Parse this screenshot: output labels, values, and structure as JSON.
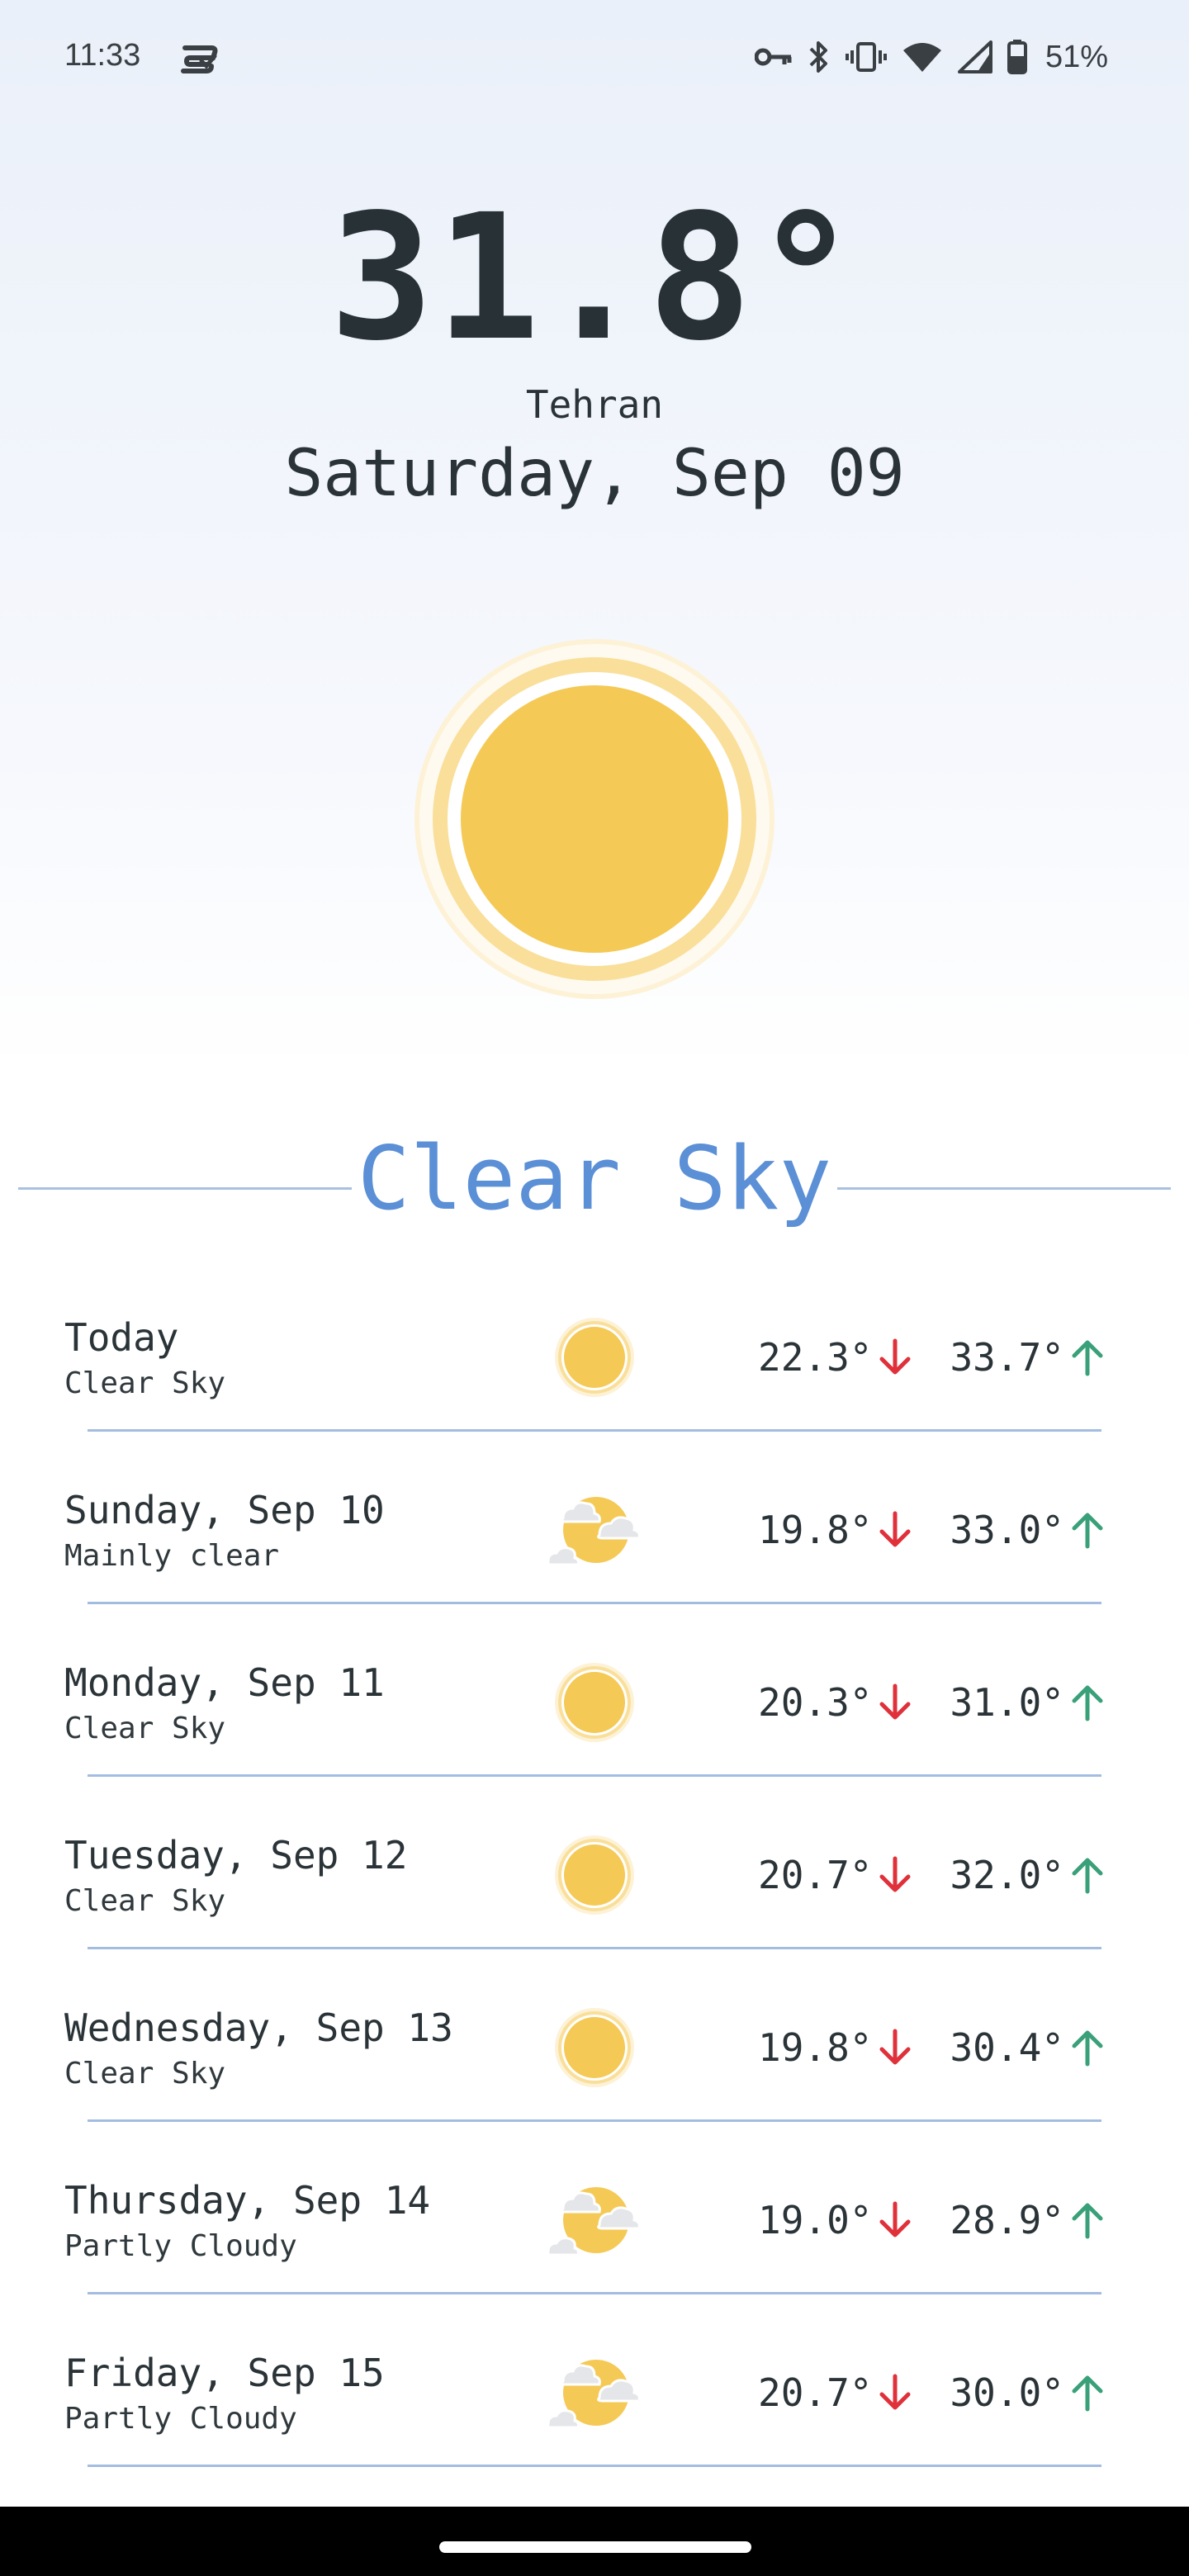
{
  "status_bar": {
    "time": "11:33",
    "battery": "51%",
    "icons": [
      "app-notification-icon",
      "vpn-key-icon",
      "bluetooth-icon",
      "vibrate-icon",
      "wifi-icon",
      "cell-signal-icon",
      "battery-icon"
    ]
  },
  "current": {
    "temperature": "31.8°",
    "city": "Tehran",
    "date": "Saturday, Sep 09",
    "condition": "Clear Sky",
    "icon": "sun-icon"
  },
  "forecast": [
    {
      "day": "Today",
      "condition": "Clear Sky",
      "icon": "sun-icon",
      "low": "22.3°",
      "high": "33.7°"
    },
    {
      "day": "Sunday, Sep 10",
      "condition": "Mainly clear",
      "icon": "partly-cloudy-icon",
      "low": "19.8°",
      "high": "33.0°"
    },
    {
      "day": "Monday, Sep 11",
      "condition": "Clear Sky",
      "icon": "sun-icon",
      "low": "20.3°",
      "high": "31.0°"
    },
    {
      "day": "Tuesday, Sep 12",
      "condition": "Clear Sky",
      "icon": "sun-icon",
      "low": "20.7°",
      "high": "32.0°"
    },
    {
      "day": "Wednesday, Sep 13",
      "condition": "Clear Sky",
      "icon": "sun-icon",
      "low": "19.8°",
      "high": "30.4°"
    },
    {
      "day": "Thursday, Sep 14",
      "condition": "Partly Cloudy",
      "icon": "partly-cloudy-icon",
      "low": "19.0°",
      "high": "28.9°"
    },
    {
      "day": "Friday, Sep 15",
      "condition": "Partly Cloudy",
      "icon": "partly-cloudy-icon",
      "low": "20.7°",
      "high": "30.0°"
    }
  ],
  "colors": {
    "accent": "#5b8fd6",
    "sun": "#f5c955",
    "low_arrow": "#e0303a",
    "high_arrow": "#3aa079",
    "divider": "#a3bde0"
  }
}
